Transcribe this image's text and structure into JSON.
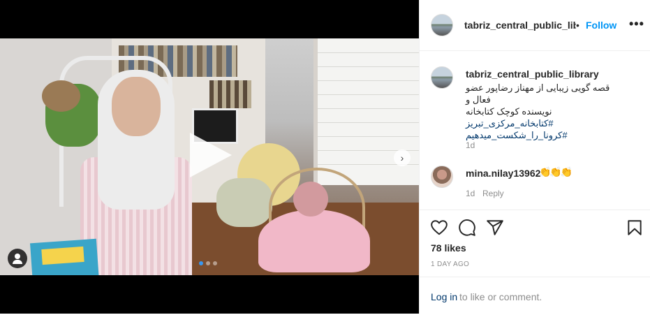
{
  "post": {
    "username": "tabriz_central_public_library",
    "header_username_display": "tabriz_central_public_librar",
    "separator": "•",
    "follow_label": "Follow",
    "more_label": "•••",
    "caption": {
      "username": "tabriz_central_public_library",
      "line1": "قصه گویی زیبایی از مهناز رضاپور عضو فعال و",
      "line2": "نویسنده کوچک کتابخانه",
      "hashtag1": "#کتابخانه_مرکزی_تبریز",
      "hashtag2": "#کرونا_را_شکست_میدهیم",
      "time": "1d"
    },
    "comments": [
      {
        "username": "mina.nilay13962",
        "emoji": "👏👏👏",
        "time": "1d",
        "reply_label": "Reply"
      }
    ],
    "likes": "78 likes",
    "posted_ago": "1 DAY AGO",
    "login_link": "Log in",
    "login_text": "to like or comment."
  },
  "media": {
    "type": "video",
    "carousel_pages": 3,
    "carousel_active": 1,
    "icons": [
      "play-icon",
      "chevron-right-icon",
      "user-tag-icon"
    ]
  },
  "colors": {
    "accent": "#0095f6",
    "link": "#00376b",
    "muted": "#8e8e8e",
    "text": "#262626",
    "carousel_active": "#3897f0"
  }
}
